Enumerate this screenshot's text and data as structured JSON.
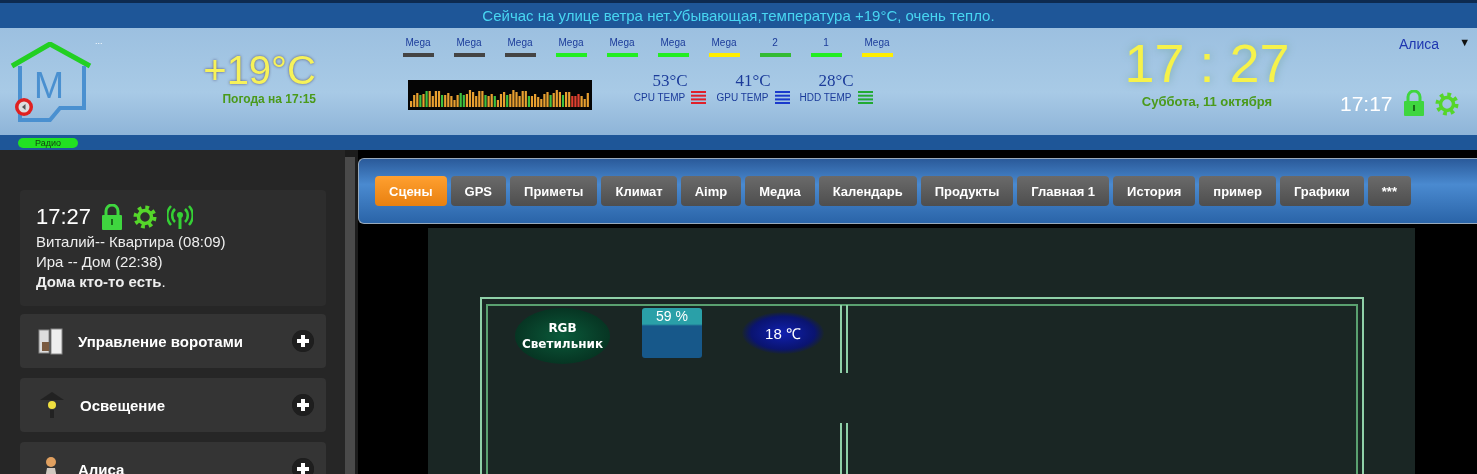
{
  "ticker": "Сейчас на улице ветра нет.Убывающая,температура +19°C, очень тепло.",
  "logo": {
    "letter": "M",
    "note": "...",
    "badge": "Радио"
  },
  "weather": {
    "temperature": "+19°C",
    "caption": "Погода на 17:15"
  },
  "controllers": [
    {
      "label": "Mega",
      "color": "#444444"
    },
    {
      "label": "Mega",
      "color": "#444444"
    },
    {
      "label": "Mega",
      "color": "#444444"
    },
    {
      "label": "Mega",
      "color": "#22ee22"
    },
    {
      "label": "Mega",
      "color": "#22ee22"
    },
    {
      "label": "Mega",
      "color": "#22ee22"
    },
    {
      "label": "Mega",
      "color": "#ffee00"
    },
    {
      "label": "2",
      "color": "#33bb33"
    },
    {
      "label": "1",
      "color": "#22ee22"
    },
    {
      "label": "Mega",
      "color": "#ffee00"
    }
  ],
  "sensors": [
    {
      "value": "53°C",
      "label": "CPU TEMP",
      "color": "#e0202a"
    },
    {
      "value": "41°C",
      "label": "GPU TEMP",
      "color": "#1a3acc"
    },
    {
      "value": "28°C",
      "label": "HDD TEMP",
      "color": "#22aa33"
    }
  ],
  "clock": {
    "time": "17 : 27",
    "date": "Суббота,  11 октября"
  },
  "user": {
    "name": "Алиса",
    "caret": "▼"
  },
  "status": {
    "time": "17:17"
  },
  "presence": {
    "time": "17:27",
    "lines": [
      "Виталий-- Квартира (08:09)",
      "Ира -- Дом (22:38)"
    ],
    "summary": "**Дома кто-то есть**."
  },
  "menu": [
    {
      "label": "Управление воротами",
      "kind": "gate"
    },
    {
      "label": "Освещение",
      "kind": "lamp"
    },
    {
      "label": "Алиса",
      "kind": "person"
    }
  ],
  "tabs": [
    {
      "label": "Сцены",
      "selected": true
    },
    {
      "label": "GPS",
      "selected": false
    },
    {
      "label": "Приметы",
      "selected": false
    },
    {
      "label": "Климат",
      "selected": false
    },
    {
      "label": "Aimp",
      "selected": false
    },
    {
      "label": "Медиа",
      "selected": false
    },
    {
      "label": "Календарь",
      "selected": false
    },
    {
      "label": "Продукты",
      "selected": false
    },
    {
      "label": "Главная 1",
      "selected": false
    },
    {
      "label": "История",
      "selected": false
    },
    {
      "label": "пример",
      "selected": false
    },
    {
      "label": "Графики",
      "selected": false
    },
    {
      "label": "***",
      "selected": false
    }
  ],
  "plan": {
    "widgets": [
      {
        "kind": "light",
        "label": "RGB Светильник"
      },
      {
        "kind": "humidity",
        "label": "59 %"
      },
      {
        "kind": "temperature",
        "label": "18 ℃"
      }
    ]
  }
}
